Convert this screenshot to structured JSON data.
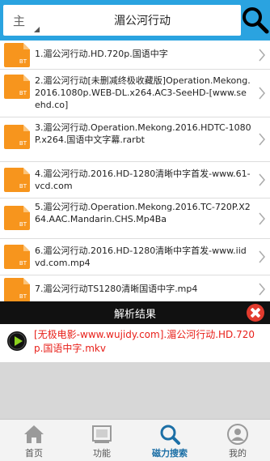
{
  "search": {
    "scope_label": "主",
    "query": "湄公河行动"
  },
  "results": [
    {
      "badge": "BT",
      "title": "1.湄公河行动.HD.720p.国语中字"
    },
    {
      "badge": "BT",
      "title": "2.湄公河行动[未删减终极收藏版]Operation.Mekong.2016.1080p.WEB-DL.x264.AC3-SeeHD-[www.seehd.co]"
    },
    {
      "badge": "BT",
      "title": "3.湄公河行动.Operation.Mekong.2016.HDTC-1080P.x264.国语中文字幕.rarbt"
    },
    {
      "badge": "BT",
      "title": "4.湄公河行动.2016.HD-1280清晰中字首发-www.61-vcd.com"
    },
    {
      "badge": "BT",
      "title": "5.湄公河行动.Operation.Mekong.2016.TC-720P.X264.AAC.Mandarin.CHS.Mp4Ba"
    },
    {
      "badge": "BT",
      "title": "6.湄公河行动.2016.HD-1280清晰中字首发-www.iidvd.com.mp4"
    },
    {
      "badge": "BT",
      "title": "7.湄公河行动TS1280清晰国语中字.mp4"
    }
  ],
  "parse_result": {
    "title": "解析结果",
    "link_text": "[无极电影-www.wujidy.com].湄公河行动.HD.720p.国语中字.mkv"
  },
  "bottom_nav": [
    {
      "label": "首页",
      "icon": "home-icon",
      "active": false
    },
    {
      "label": "功能",
      "icon": "function-icon",
      "active": false
    },
    {
      "label": "磁力搜索",
      "icon": "search-icon",
      "active": true
    },
    {
      "label": "我的",
      "icon": "user-icon",
      "active": false
    }
  ],
  "colors": {
    "topbar": "#2aa3e0",
    "file_icon": "#f7951d",
    "result_link": "#e8201a",
    "active_tab": "#1c6fa6"
  }
}
